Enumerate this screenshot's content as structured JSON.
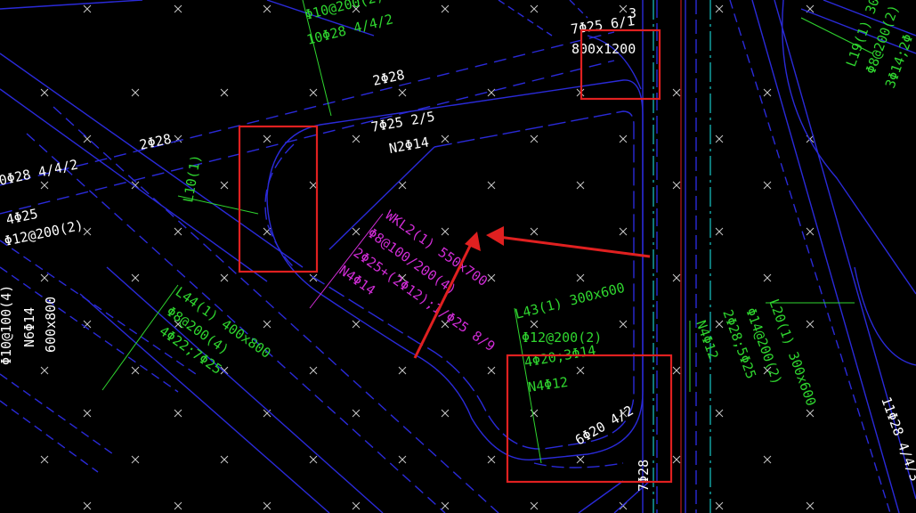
{
  "colors": {
    "background": "#000000",
    "beam_line": "#2a2ad8",
    "label_white": "#ffffff",
    "label_green": "#2fd62f",
    "label_magenta": "#d02cd6",
    "highlight_red": "#e02020",
    "axis_cyan": "#17c7c7",
    "axis_red": "#e02020"
  },
  "labels": {
    "top_right_a": "7Φ25 6/1",
    "top_right_b": "3",
    "top_right_c": "800x1200",
    "upper_left_green_a": "Φ10@200(2)",
    "upper_left_green_b": "10Φ28 4/4/2",
    "beam_top_bar": "2Φ28",
    "beam_top_steel": "7Φ25 2/5",
    "beam_top_waist": "N2Φ14",
    "left_bar": "2Φ28",
    "left_bar_b": "0Φ28 4/4/2",
    "left_steel_a": "4Φ25",
    "left_steel_b": "Φ12@200(2)",
    "left_green_l10": "L10(1)",
    "left_edge_a": "N6Φ14",
    "left_edge_b": "600x800",
    "left_edge_c": "Φ10@100(4)",
    "l44_a": "L44(1) 400x800",
    "l44_b": "Φ8@200(4)",
    "l44_c": "4Φ22;7Φ25",
    "wkl_a": "WKL2(1) 550x700",
    "wkl_b": "Φ8@100/200(4)",
    "wkl_c": "2Φ25+(2Φ12);1/Φ25 8/9",
    "wkl_d": "N4Φ14",
    "l43_a": "L43(1) 300x600",
    "l43_b": "Φ12@200(2)",
    "l43_c": "4Φ20;3Φ14",
    "l43_d": "N4Φ12",
    "bottom_steel": "6Φ20 4/2",
    "bottom_bar": "7Φ28",
    "right_green_n4": "N4Φ12",
    "right_green_a": "2Φ28;5Φ25",
    "l20_a": "L20(1) 300x600",
    "l20_b": "Φ14@200(2)",
    "l19_a": "L19(1) 300",
    "l19_b": "Φ8@200(2)",
    "l19_c": "3Φ14;2Φ",
    "far_right": "11Φ28 4/4/3"
  }
}
